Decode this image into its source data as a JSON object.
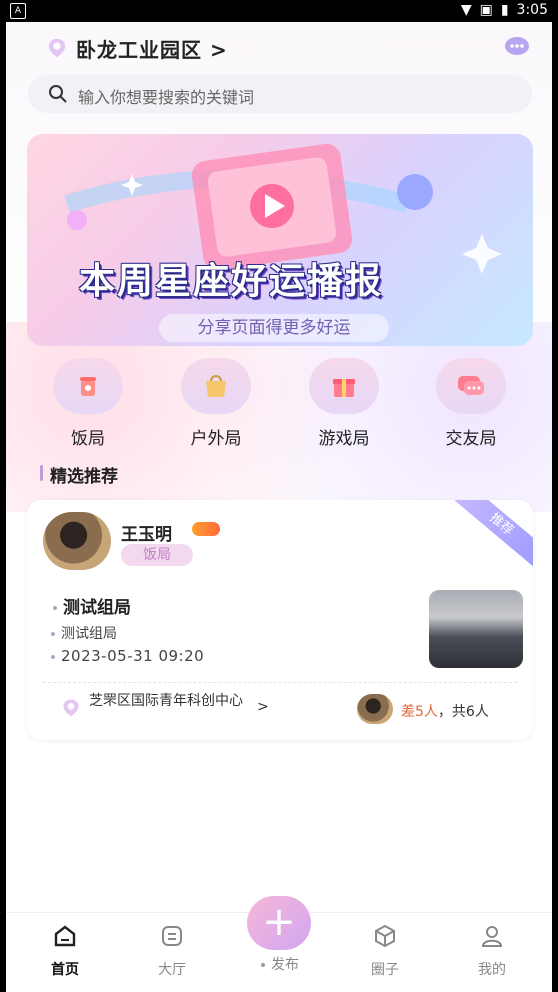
{
  "status": {
    "time": "3:05"
  },
  "header": {
    "location": "卧龙工业园区 >"
  },
  "search": {
    "placeholder": "输入你想要搜索的关键词"
  },
  "banner": {
    "title": "本周星座好运播报",
    "subtitle": "分享页面得更多好运"
  },
  "categories": [
    {
      "label": "饭局",
      "icon": "cup-icon"
    },
    {
      "label": "户外局",
      "icon": "bag-icon"
    },
    {
      "label": "游戏局",
      "icon": "gift-icon"
    },
    {
      "label": "交友局",
      "icon": "chat-icon"
    }
  ],
  "section": {
    "title": "精选推荐"
  },
  "card": {
    "ribbon": "推荐",
    "user": {
      "name": "王玉明",
      "tag": "饭局"
    },
    "event": {
      "title": "测试组局",
      "desc": "测试组局",
      "time": "2023-05-31 09:20"
    },
    "address": "芝罘区国际青年科创中心",
    "people": {
      "short": "差5人",
      "total": "，共6人"
    }
  },
  "tabs": [
    {
      "label": "首页",
      "icon": "home-icon",
      "active": true
    },
    {
      "label": "大厅",
      "icon": "hall-icon"
    },
    {
      "label": "发布",
      "icon": "plus-icon"
    },
    {
      "label": "圈子",
      "icon": "cube-icon"
    },
    {
      "label": "我的",
      "icon": "user-icon"
    }
  ],
  "colors": {
    "accent": "#d7a4ee",
    "pink": "#f6d8ea",
    "orange": "#e06a3a"
  }
}
